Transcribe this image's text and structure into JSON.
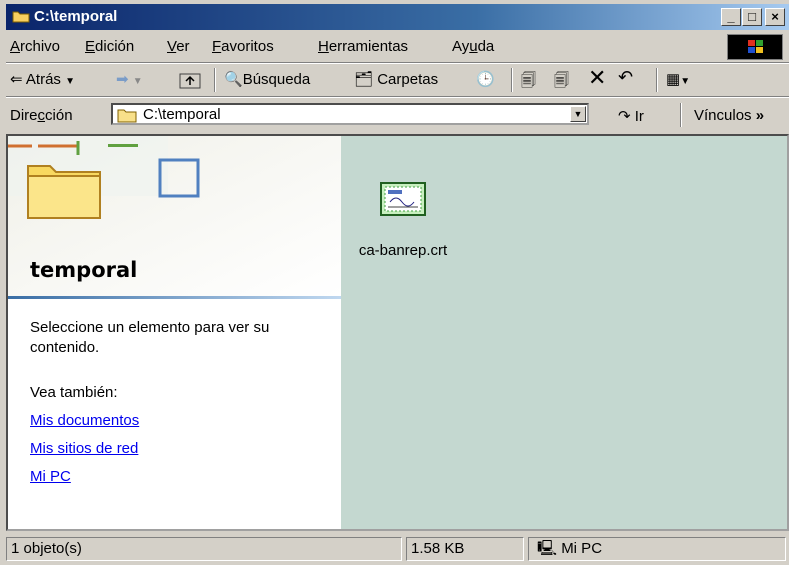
{
  "window": {
    "title": "C:\\temporal",
    "buttons": [
      "_",
      "□",
      "×"
    ]
  },
  "menu": {
    "items": [
      {
        "mnemonic": "A",
        "rest": "rchivo"
      },
      {
        "mnemonic": "E",
        "rest": "dición"
      },
      {
        "mnemonic": "V",
        "rest": "er"
      },
      {
        "mnemonic": "F",
        "rest": "avoritos"
      },
      {
        "mnemonic": "H",
        "rest": "erramientas"
      },
      {
        "pre": "Ay",
        "mnemonic": "u",
        "rest": "da"
      }
    ]
  },
  "toolbar": {
    "back_label": "Atrás",
    "search_label": "Búsqueda",
    "folders_label": "Carpetas"
  },
  "address": {
    "label_pre": "Dire",
    "label_mnemonic": "c",
    "label_post": "ción",
    "value": "C:\\temporal",
    "go_label": "Ir",
    "links_label": "Vínculos"
  },
  "left_pane": {
    "title": "temporal",
    "description": "Seleccione un elemento para ver su contenido.",
    "see_also": "Vea también:",
    "links": [
      "Mis documentos",
      "Mis sitios de red",
      "Mi PC"
    ]
  },
  "files": [
    {
      "name": "ca-banrep.crt",
      "icon": "certificate-icon"
    }
  ],
  "status": {
    "objects": "1 objeto(s)",
    "size": "1.58 KB",
    "zone": "Mi PC"
  },
  "colors": {
    "title_start": "#0a246a",
    "title_end": "#a6caf0",
    "chrome": "#d4d0c8",
    "content_bg": "#c4d8d0",
    "link": "#0000ee"
  }
}
